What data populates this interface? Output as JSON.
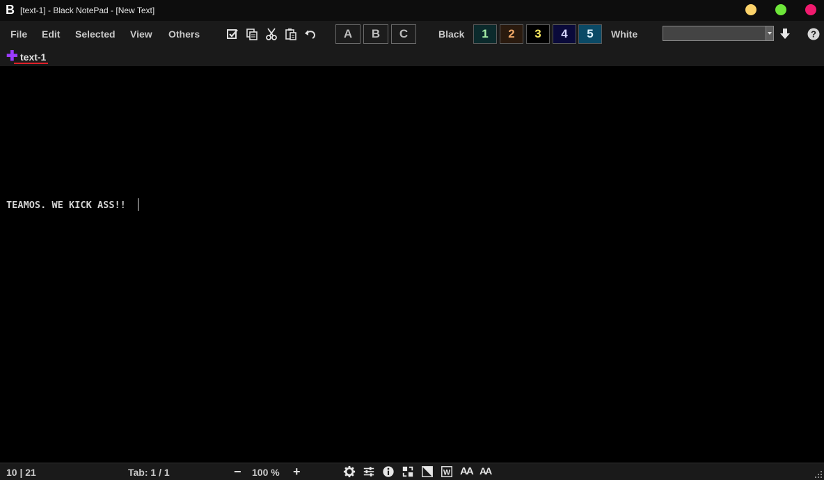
{
  "window": {
    "logo": "B",
    "title": "[text-1] - Black NotePad - [New Text]"
  },
  "menu": {
    "file": "File",
    "edit": "Edit",
    "selected": "Selected",
    "view": "View",
    "others": "Others"
  },
  "toolbar": {
    "icons": [
      "select-all-icon",
      "copy-icon",
      "cut-icon",
      "paste-icon",
      "undo-icon"
    ],
    "abc": [
      "A",
      "B",
      "C"
    ],
    "theme_black": "Black",
    "theme_white": "White",
    "themes": [
      {
        "label": "1",
        "bg": "#0b2a2c",
        "fg": "#a8f0a8"
      },
      {
        "label": "2",
        "bg": "#2a1a0e",
        "fg": "#f0a868"
      },
      {
        "label": "3",
        "bg": "#000000",
        "fg": "#f8e860"
      },
      {
        "label": "4",
        "bg": "#0a0a3a",
        "fg": "#d8d8ff"
      },
      {
        "label": "5",
        "bg": "#0b4a66",
        "fg": "#e0f4ff"
      }
    ],
    "font_select_value": ""
  },
  "tabs": [
    {
      "label": "text-1",
      "active": true
    }
  ],
  "editor": {
    "content": "TEAMOS. WE KICK ASS!!"
  },
  "status": {
    "position": "10 | 21",
    "tab_info": "Tab: 1 / 1",
    "zoom_minus": "−",
    "zoom": "100 %",
    "zoom_plus": "+"
  },
  "colors": {
    "accent_purple": "#9a3bff",
    "tab_underline": "#e0202a",
    "win_min": "#fbd26a",
    "win_max": "#6ee63a",
    "win_close": "#f01a6e"
  }
}
